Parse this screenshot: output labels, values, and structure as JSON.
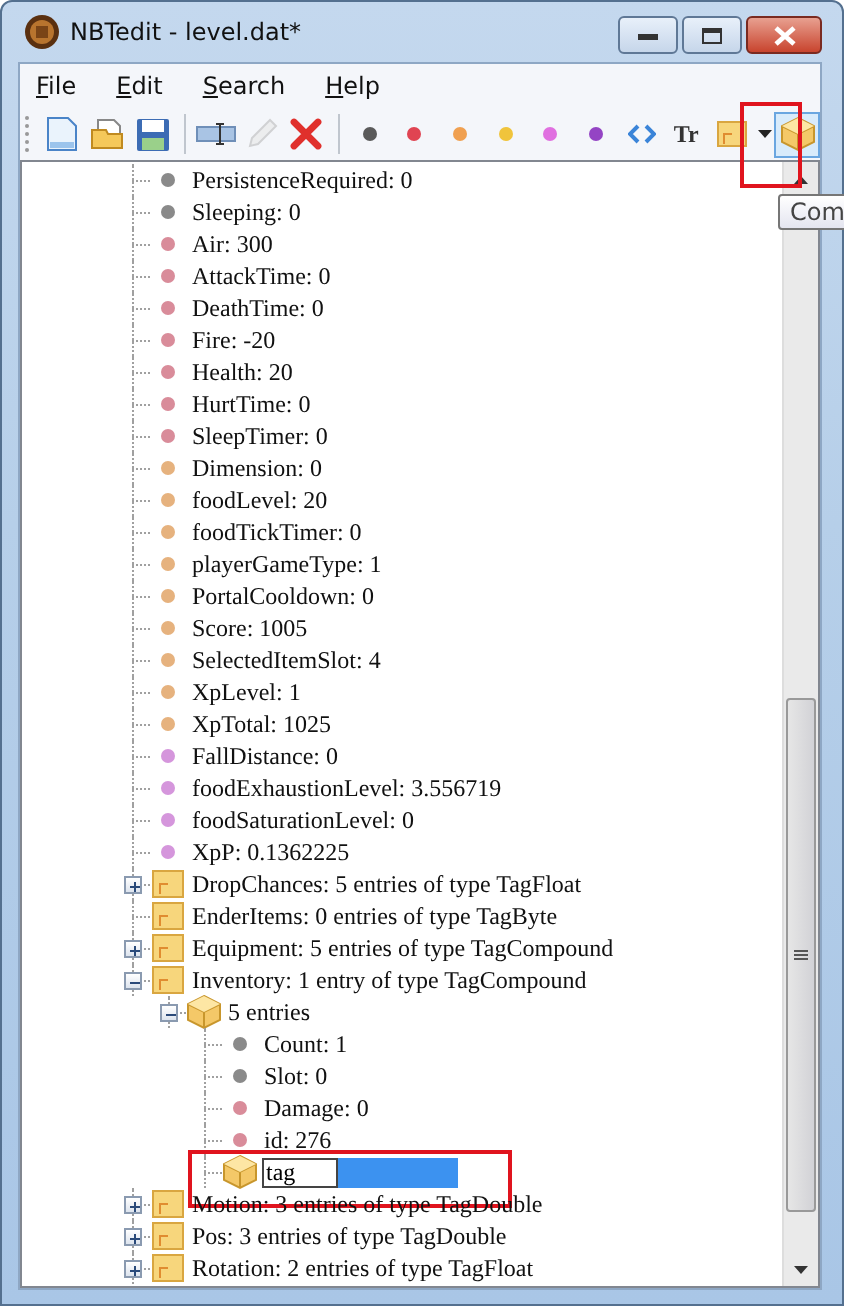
{
  "window": {
    "title": "NBTedit - level.dat*"
  },
  "menu": [
    "File",
    "Edit",
    "Search",
    "Help"
  ],
  "toolbar": [
    {
      "kind": "new",
      "disabled": false,
      "highlighted": false
    },
    {
      "kind": "open",
      "disabled": false,
      "highlighted": false
    },
    {
      "kind": "save",
      "disabled": false,
      "highlighted": false
    },
    {
      "kind": "separator"
    },
    {
      "kind": "rename",
      "disabled": false,
      "highlighted": false
    },
    {
      "kind": "edit",
      "disabled": true,
      "highlighted": false
    },
    {
      "kind": "delete",
      "disabled": false,
      "highlighted": false
    },
    {
      "kind": "separator"
    },
    {
      "kind": "dot",
      "color": "#5a5a5a",
      "disabled": false,
      "highlighted": false
    },
    {
      "kind": "dot",
      "color": "#e04452",
      "disabled": false,
      "highlighted": false
    },
    {
      "kind": "dot",
      "color": "#f0a050",
      "disabled": false,
      "highlighted": false
    },
    {
      "kind": "dot",
      "color": "#f0c43c",
      "disabled": false,
      "highlighted": false
    },
    {
      "kind": "dot",
      "color": "#e070e0",
      "disabled": false,
      "highlighted": false
    },
    {
      "kind": "dot",
      "color": "#9444c4",
      "disabled": false,
      "highlighted": false
    },
    {
      "kind": "code",
      "disabled": false,
      "highlighted": false
    },
    {
      "kind": "text",
      "label": "Tr",
      "disabled": false,
      "highlighted": false
    },
    {
      "kind": "list-dropdown",
      "disabled": false,
      "highlighted": false
    },
    {
      "kind": "compound",
      "disabled": false,
      "highlighted": true
    }
  ],
  "tooltip": "Com",
  "tree": [
    {
      "kind": "leaf",
      "label": "PersistenceRequired: 0",
      "color": "#8a8a8a"
    },
    {
      "kind": "leaf",
      "label": "Sleeping: 0",
      "color": "#8a8a8a"
    },
    {
      "kind": "leaf",
      "label": "Air: 300",
      "color": "#d98c9a"
    },
    {
      "kind": "leaf",
      "label": "AttackTime: 0",
      "color": "#d98c9a"
    },
    {
      "kind": "leaf",
      "label": "DeathTime: 0",
      "color": "#d98c9a"
    },
    {
      "kind": "leaf",
      "label": "Fire: -20",
      "color": "#d98c9a"
    },
    {
      "kind": "leaf",
      "label": "Health: 20",
      "color": "#d98c9a"
    },
    {
      "kind": "leaf",
      "label": "HurtTime: 0",
      "color": "#d98c9a"
    },
    {
      "kind": "leaf",
      "label": "SleepTimer: 0",
      "color": "#d98c9a"
    },
    {
      "kind": "leaf",
      "label": "Dimension: 0",
      "color": "#e6b27e"
    },
    {
      "kind": "leaf",
      "label": "foodLevel: 20",
      "color": "#e6b27e"
    },
    {
      "kind": "leaf",
      "label": "foodTickTimer: 0",
      "color": "#e6b27e"
    },
    {
      "kind": "leaf",
      "label": "playerGameType: 1",
      "color": "#e6b27e"
    },
    {
      "kind": "leaf",
      "label": "PortalCooldown: 0",
      "color": "#e6b27e"
    },
    {
      "kind": "leaf",
      "label": "Score: 1005",
      "color": "#e6b27e"
    },
    {
      "kind": "leaf",
      "label": "SelectedItemSlot: 4",
      "color": "#e6b27e"
    },
    {
      "kind": "leaf",
      "label": "XpLevel: 1",
      "color": "#e6b27e"
    },
    {
      "kind": "leaf",
      "label": "XpTotal: 1025",
      "color": "#e6b27e"
    },
    {
      "kind": "leaf",
      "label": "FallDistance: 0",
      "color": "#d596dc"
    },
    {
      "kind": "leaf",
      "label": "foodExhaustionLevel: 3.556719",
      "color": "#d596dc"
    },
    {
      "kind": "leaf",
      "label": "foodSaturationLevel: 0",
      "color": "#d596dc"
    },
    {
      "kind": "leaf",
      "label": "XpP: 0.1362225",
      "color": "#d596dc"
    },
    {
      "kind": "list",
      "label": "DropChances: 5 entries of type TagFloat",
      "expanded": false
    },
    {
      "kind": "empty-list",
      "label": "EnderItems: 0 entries of type TagByte"
    },
    {
      "kind": "list",
      "label": "Equipment: 5 entries of type TagCompound",
      "expanded": false
    },
    {
      "kind": "list",
      "label": "Inventory: 1 entry of type TagCompound",
      "expanded": true,
      "children": [
        {
          "kind": "compound",
          "label": "5 entries",
          "expanded": true,
          "children": [
            {
              "kind": "leaf",
              "label": "Count: 1",
              "color": "#8a8a8a"
            },
            {
              "kind": "leaf",
              "label": "Slot: 0",
              "color": "#8a8a8a"
            },
            {
              "kind": "leaf",
              "label": "Damage: 0",
              "color": "#d98c9a"
            },
            {
              "kind": "leaf",
              "label": "id: 276",
              "color": "#d98c9a"
            },
            {
              "kind": "compound-editing",
              "value": "tag",
              "highlighted": true
            }
          ]
        }
      ]
    },
    {
      "kind": "list",
      "label": "Motion: 3 entries of type TagDouble",
      "expanded": false
    },
    {
      "kind": "list",
      "label": "Pos: 3 entries of type TagDouble",
      "expanded": false
    },
    {
      "kind": "list",
      "label": "Rotation: 2 entries of type TagFloat",
      "expanded": false
    }
  ]
}
